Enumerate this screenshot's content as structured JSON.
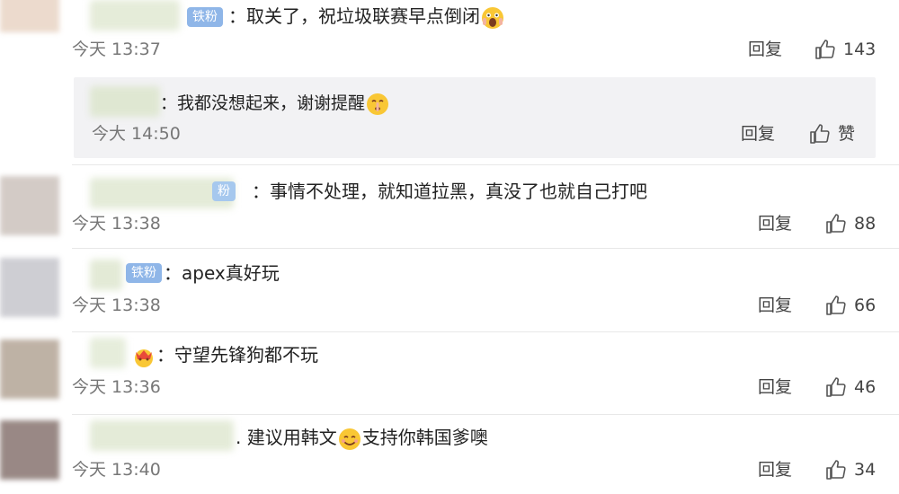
{
  "comments": [
    {
      "badge": "铁粉",
      "text": "：取关了，祝垃圾联赛早点倒闭",
      "time": "今天 13:37",
      "reply_label": "回复",
      "likes": "143"
    },
    {
      "badge": "粉",
      "text": "：事情不处理，就知道拉黑，真没了也就自己打吧",
      "time": "今天 13:38",
      "reply_label": "回复",
      "likes": "88"
    },
    {
      "badge": "铁粉",
      "text": "：apex真好玩",
      "time": "今天 13:38",
      "reply_label": "回复",
      "likes": "66"
    },
    {
      "text": "：守望先锋狗都不玩",
      "time": "今天 13:36",
      "reply_label": "回复",
      "likes": "46"
    },
    {
      "text_a": ". 建议用韩文",
      "text_b": "支持你韩国爹噢",
      "time": "今天 13:40",
      "reply_label": "回复",
      "likes": "34"
    }
  ],
  "subreply": {
    "text": "：我都没想起来，谢谢提醒",
    "time": "今大 14:50",
    "reply_label": "回复",
    "like_label": "赞"
  },
  "icons": {
    "like": "thumbs-up-icon",
    "emoji_scream": "scream-emoji-icon",
    "emoji_shush": "shushing-emoji-icon",
    "emoji_smile": "smiling-emoji-icon",
    "emoji_crown": "crown-badge-icon"
  }
}
